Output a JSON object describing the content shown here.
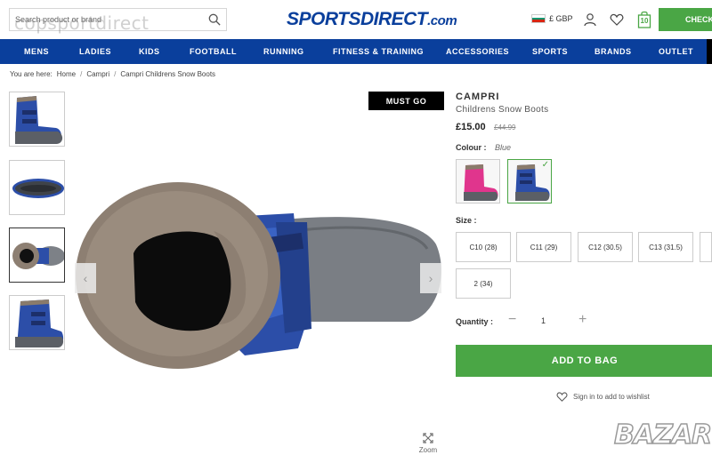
{
  "header": {
    "search_placeholder": "Search product or brand",
    "watermark": "copsportdirect",
    "logo_main": "SPORTSDIRECT",
    "logo_suffix": ".com",
    "currency": "£ GBP",
    "bag_count": "10",
    "checkout_label": "CHECK"
  },
  "nav": {
    "items": [
      "MENS",
      "LADIES",
      "KIDS",
      "FOOTBALL",
      "RUNNING",
      "FITNESS & TRAINING",
      "ACCESSORIES",
      "SPORTS",
      "BRANDS",
      "OUTLET"
    ]
  },
  "breadcrumb": {
    "prefix": "You are here:",
    "items": [
      "Home",
      "Campri",
      "Campri Childrens Snow Boots"
    ]
  },
  "gallery": {
    "badge": "MUST GO",
    "zoom_label": "Zoom",
    "thumbnails": [
      "side-view",
      "sole-view",
      "top-view",
      "front-view"
    ]
  },
  "product": {
    "brand": "CAMPRI",
    "name": "Childrens Snow Boots",
    "price": "£15.00",
    "was_price": "£44.99",
    "colour_label": "Colour :",
    "colour_value": "Blue",
    "colours": [
      {
        "name": "Pink",
        "hex": "#e0358d"
      },
      {
        "name": "Blue",
        "hex": "#2c4ea8"
      }
    ],
    "size_label": "Size :",
    "sizes": [
      "C10 (28)",
      "C11 (29)",
      "C12 (30.5)",
      "C13 (31.5)",
      "2 (34)"
    ],
    "quantity_label": "Quantity :",
    "quantity": "1",
    "add_to_bag": "ADD TO BAG",
    "wishlist": "Sign in to add to wishlist"
  },
  "overlay": {
    "bazar": "BAZAR"
  },
  "colors": {
    "brand_blue": "#0a3f9c",
    "accent_green": "#4aa645"
  }
}
